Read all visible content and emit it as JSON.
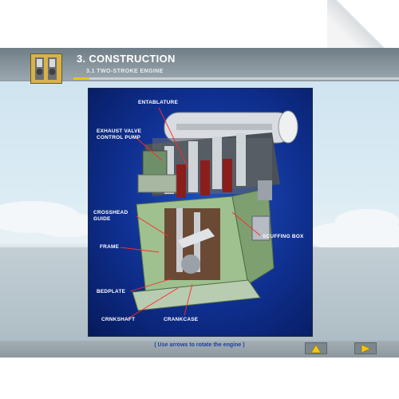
{
  "header": {
    "title": "3. CONSTRUCTION",
    "subtitle": "3.1 TWO-STROKE ENGINE",
    "progress": 0.05
  },
  "labels": {
    "entablature": "ENTABLATURE",
    "exhaust_valve_pump": "EXHAUST VALVE\nCONTROL PUMP",
    "crosshead_guide": "CROSSHEAD\nGUIDE",
    "frame": "FRAME",
    "bedplate": "BEDPLATE",
    "crankshaft": "CRNKSHAFT",
    "crankcase": "CRANKCASE",
    "scuffing_box": "SCUFFING BOX"
  },
  "instruction": "( Use arrows to rotate the engine )",
  "icons": {
    "header": "engine-parts-icon",
    "rotate_left": "arrow-left-icon",
    "rotate_right": "arrow-right-icon",
    "previous": "triangle-up-icon",
    "next": "triangle-right-icon"
  },
  "colors": {
    "accent": "#f0c020",
    "panel_blue": "#0f2f8f",
    "instruction_text": "#1a3fa8"
  }
}
